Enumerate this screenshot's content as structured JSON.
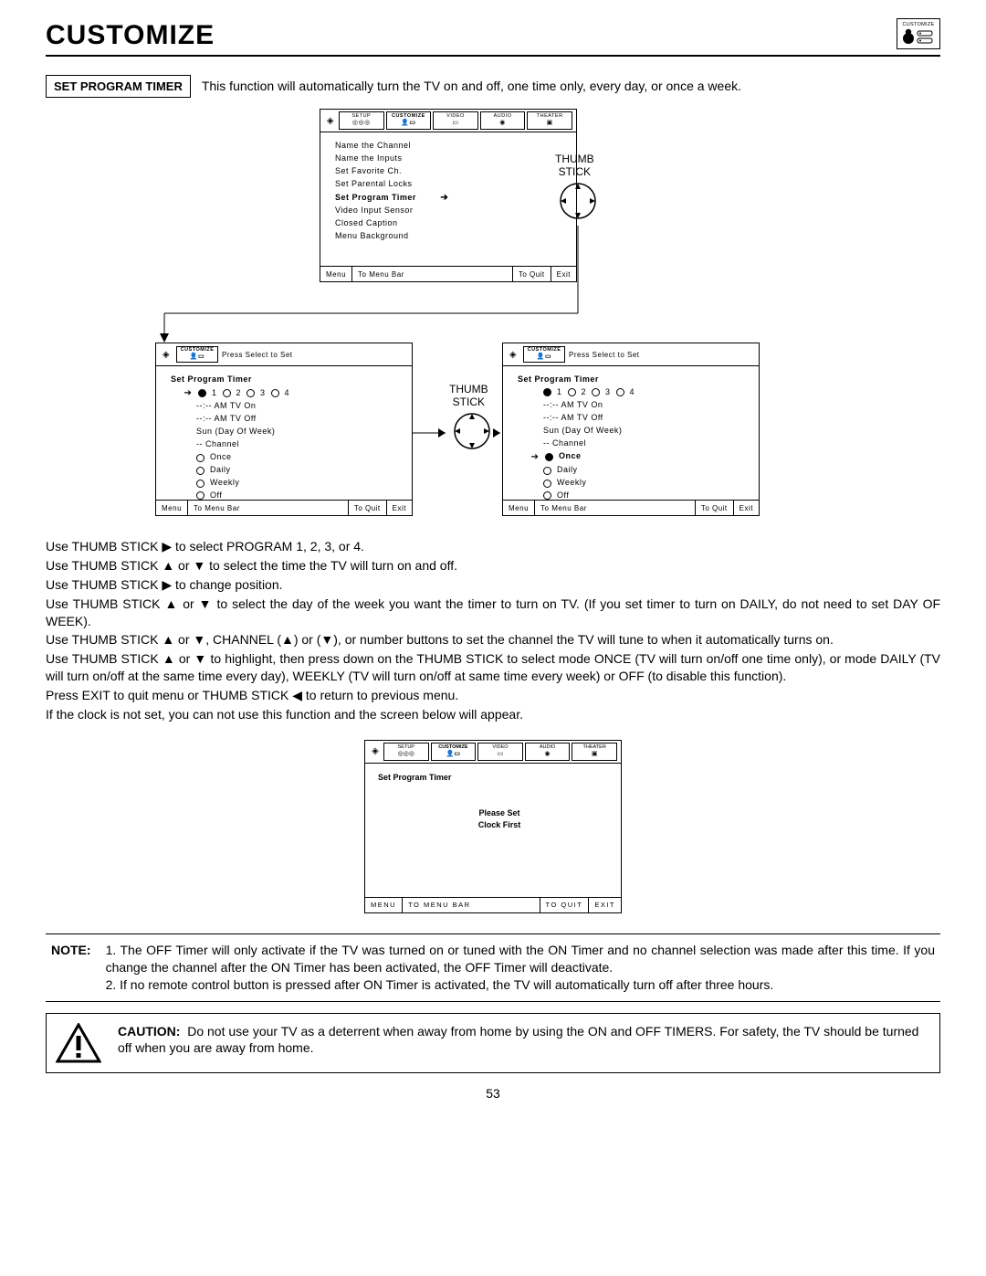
{
  "header": {
    "title": "CUSTOMIZE",
    "corner_icon_label": "CUSTOMIZE"
  },
  "section": {
    "label": "SET PROGRAM TIMER",
    "desc": "This function will automatically turn the TV on and off, one time only, every day, or once a week."
  },
  "tabs": {
    "setup": "SETUP",
    "customize": "CUSTOMIZE",
    "video": "VIDEO",
    "audio": "AUDIO",
    "theater": "THEATER"
  },
  "thumbstick_label": "THUMB\nSTICK",
  "osd_top_menu": {
    "items": [
      "Name the Channel",
      "Name the Inputs",
      "Set Favorite Ch.",
      "Set Parental Locks",
      "Set Program Timer",
      "Video Input Sensor",
      "Closed Caption",
      "Menu Background"
    ],
    "highlight_index": 4
  },
  "osd_detail": {
    "press_select": "Press Select to Set",
    "heading": "Set Program Timer",
    "programs": [
      "1",
      "2",
      "3",
      "4"
    ],
    "tv_on": "--:-- AM TV On",
    "tv_off": "--:-- AM TV Off",
    "day": "Sun (Day Of Week)",
    "channel": "-- Channel",
    "modes": [
      "Once",
      "Daily",
      "Weekly",
      "Off"
    ]
  },
  "osd_footer": {
    "menu": "Menu",
    "to_menu_bar": "To Menu Bar",
    "to_quit": "To Quit",
    "exit": "Exit"
  },
  "osd_footer_caps": {
    "menu": "MENU",
    "to_menu_bar": "TO MENU BAR",
    "to_quit": "TO QUIT",
    "exit": "EXIT"
  },
  "instructions": {
    "l1a": "Use THUMB STICK ",
    "l1b": " to select PROGRAM 1, 2, 3, or 4.",
    "l2a": "Use THUMB STICK ",
    "l2b": " or ",
    "l2c": " to select the time the TV will turn on and off.",
    "l3a": "Use THUMB STICK ",
    "l3b": " to change position.",
    "l4a": "Use THUMB STICK ",
    "l4b": " or ",
    "l4c": " to select the day of the week you want the timer to turn on TV. (If you set timer to turn on DAILY, do not need to set DAY OF WEEK).",
    "l5a": "Use THUMB STICK ",
    "l5b": " or ",
    "l5c": ", CHANNEL (",
    "l5d": ") or (",
    "l5e": "), or number buttons to set the channel the TV will tune to when it automatically turns on.",
    "l6a": "Use THUMB STICK ",
    "l6b": " or ",
    "l6c": " to highlight, then press down on the THUMB STICK to select mode ONCE (TV will turn on/off one time only), or mode DAILY (TV will turn on/off at the same time every day), WEEKLY (TV will turn on/off at same time every week) or OFF (to disable this function).",
    "l7a": "Press EXIT to quit menu or THUMB STICK ",
    "l7b": " to return to previous menu.",
    "l8": "If the clock is not set, you can not use this function and the screen below will appear."
  },
  "clock_osd": {
    "heading": "Set Program Timer",
    "msg1": "Please Set",
    "msg2": "Clock First"
  },
  "note": {
    "label": "NOTE:",
    "line1": "1. The OFF Timer will only activate if the TV was turned on or tuned with the ON Timer and no channel selection was made after this time.  If you change the channel after the ON Timer has been activated, the OFF Timer will deactivate.",
    "line2": "2. If no remote control button is pressed after ON Timer is activated, the TV will automatically turn off after three hours."
  },
  "caution": {
    "label": "CAUTION:",
    "text": "Do not use your TV as a deterrent when away from home by using the ON and OFF TIMERS.  For safety, the TV should be turned off when you are away from home."
  },
  "page_number": "53",
  "glyph": {
    "right": "▶",
    "left": "◀",
    "up": "▲",
    "down": "▼",
    "right_small": "➔"
  }
}
